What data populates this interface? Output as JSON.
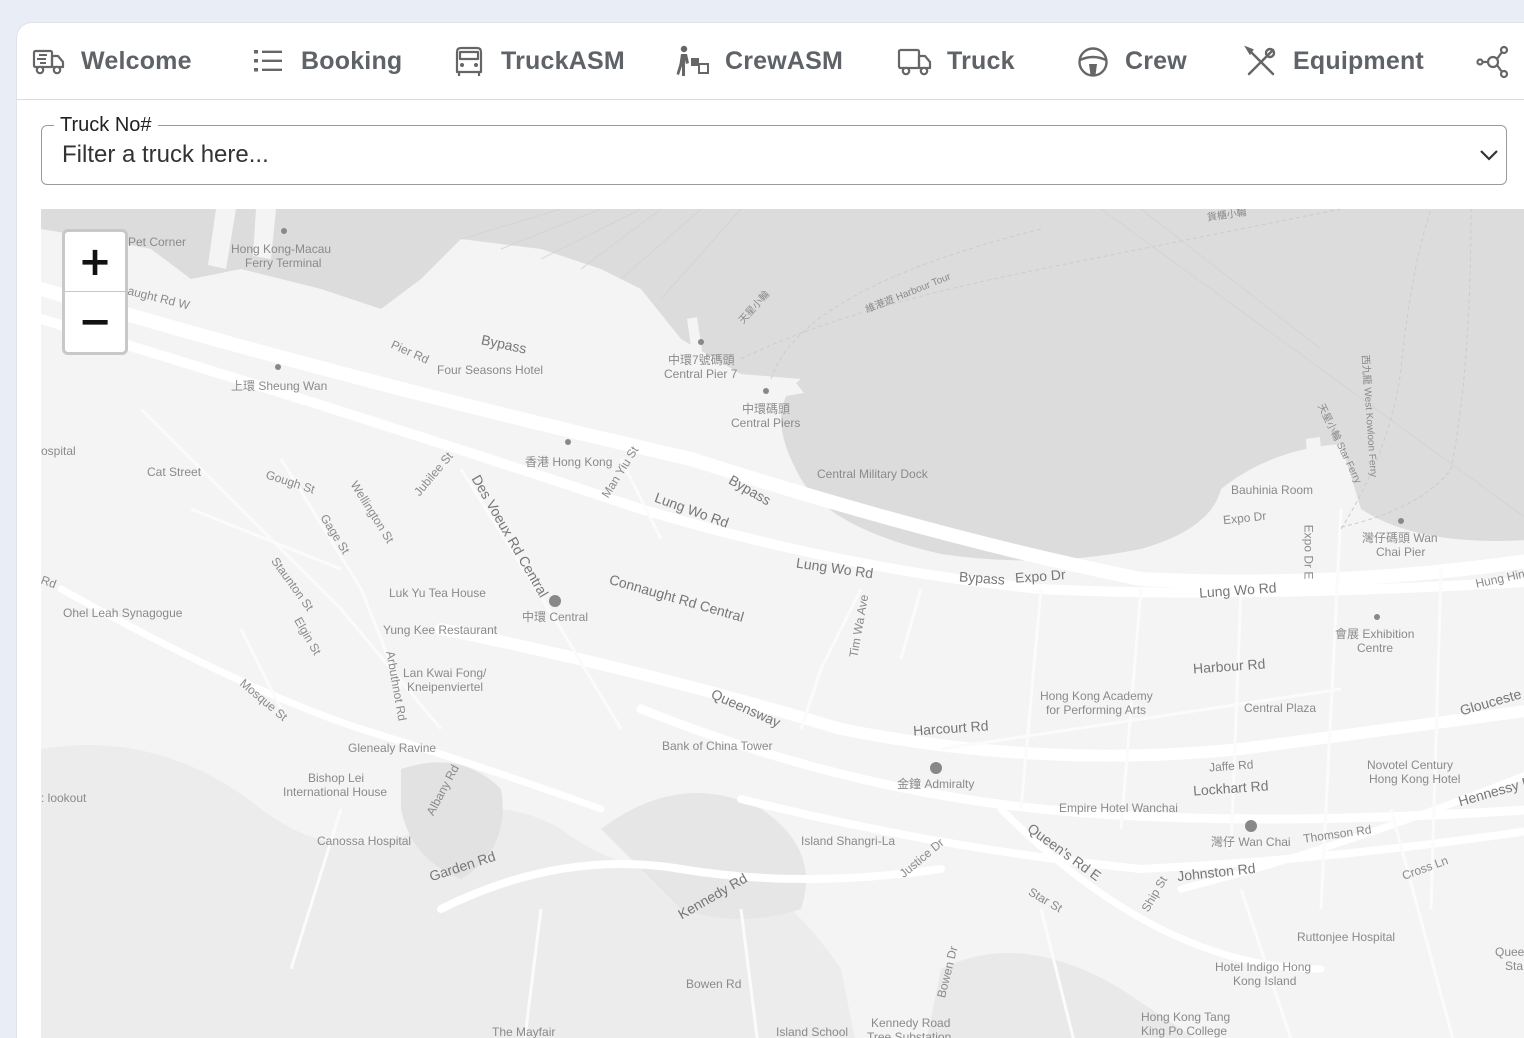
{
  "tabs": [
    {
      "name": "welcome",
      "label": "Welcome",
      "icon": "truck-fast-icon"
    },
    {
      "name": "booking",
      "label": "Booking",
      "icon": "list-icon"
    },
    {
      "name": "truckasm",
      "label": "TruckASM",
      "icon": "car-front-icon"
    },
    {
      "name": "crewasm",
      "label": "CrewASM",
      "icon": "people-carry-icon"
    },
    {
      "name": "truck",
      "label": "Truck",
      "icon": "truck-icon"
    },
    {
      "name": "crew",
      "label": "Crew",
      "icon": "steering-wheel-icon"
    },
    {
      "name": "equipment",
      "label": "Equipment",
      "icon": "tools-icon"
    },
    {
      "name": "more",
      "label": "",
      "icon": "network-icon"
    }
  ],
  "filter": {
    "legend": "Truck No#",
    "placeholder": "Filter a truck here..."
  },
  "map": {
    "zoom_in": "+",
    "zoom_out": "−",
    "labels": {
      "pet_corner": "Pet Corner",
      "hk_macau": "Hong Kong-Macau",
      "ferry_terminal": "Ferry Terminal",
      "connaught_w": "aught Rd W",
      "pier_rd": "Pier Rd",
      "bypass1": "Bypass",
      "four_seasons": "Four Seasons Hotel",
      "pier7_cn": "中環7號碼頭",
      "pier7": "Central Pier 7",
      "piers_cn": "中環碼頭",
      "piers": "Central Piers",
      "sheung_wan": "上環 Sheung Wan",
      "hospital": "ospital",
      "cat_street": "Cat Street",
      "gough_st": "Gough St",
      "wellington_st": "Wellington St",
      "jubilee_st": "Jubilee St",
      "des_voeux": "Des Voeux Rd Central",
      "hong_kong_stn": "香港 Hong Kong",
      "man_yiu_st": "Man Yiu St",
      "lung_wo_rd1": "Lung Wo Rd",
      "bypass2": "Bypass",
      "military_dock": "Central Military Dock",
      "bauhinia": "Bauhinia Room",
      "expo_dr": "Expo Dr",
      "expo_dr_e": "Expo Dr E",
      "wan_chai_pier": "灣仔碼頭 Wan",
      "wan_chai_pier2": "Chai Pier",
      "gage_st": "Gage St",
      "staunton_st": "Staunton St",
      "luk_yu": "Luk Yu Tea House",
      "central_stn": "中環 Central",
      "connaught_central": "Connaught Rd Central",
      "lung_wo_rd2": "Lung Wo Rd",
      "bypass_expo": "Bypass",
      "expo_dr2": "Expo Dr",
      "lung_wo_rd3": "Lung Wo Rd",
      "hung_hing": "Hung Hing",
      "rd": "Rd",
      "ohel_leah": "Ohel Leah Synagogue",
      "elgin_st": "Elgin St",
      "yung_kee": "Yung Kee Restaurant",
      "arbuthnot": "Arbuthnot Rd",
      "lan_kwai": "Lan Kwai Fong/",
      "kneipen": "Kneipenviertel",
      "tim_wa": "Tim Wa Ave",
      "exhibition": "會展 Exhibition",
      "centre": "Centre",
      "harbour_rd": "Harbour Rd",
      "mosque_st": "Mosque St",
      "queensway": "Queensway",
      "hkapa1": "Hong Kong Academy",
      "hkapa2": "for Performing Arts",
      "central_plaza": "Central Plaza",
      "gloucester": "Glouceste",
      "glenealy": "Glenealy Ravine",
      "bank_china": "Bank of China Tower",
      "harcourt": "Harcourt Rd",
      "bishop1": "Bishop Lei",
      "bishop2": "International House",
      "albany": "Albany Rd",
      "admiralty": "金鐘 Admiralty",
      "jaffe": "Jaffe Rd",
      "novotel1": "Novotel Century",
      "novotel2": "Hong Kong Hotel",
      "lookout": ": lookout",
      "lockhart": "Lockhart Rd",
      "hennessy": "Hennessy Rd",
      "empire": "Empire Hotel Wanchai",
      "canossa": "Canossa Hospital",
      "island_shangri": "Island Shangri-La",
      "queens_e": "Queen's Rd E",
      "wan_chai_stn": "灣仔 Wan Chai",
      "thomson": "Thomson Rd",
      "garden_rd": "Garden Rd",
      "justice_dr": "Justice Dr",
      "kennedy_rd": "Kennedy Rd",
      "star_st": "Star St",
      "ship_st": "Ship St",
      "johnston": "Johnston Rd",
      "cross_ln": "Cross Ln",
      "ruttonjee": "Ruttonjee Hospital",
      "queen_e1": "Queen E",
      "queen_e2": "Sta",
      "bowen_dr": "Bowen Dr",
      "bowen_rd": "Bowen Rd",
      "indigo1": "Hotel Indigo Hong",
      "indigo2": "Kong Island",
      "kennedy_sub1": "Kennedy Road",
      "kennedy_sub2": "Tree Substation",
      "tang1": "Hong Kong Tang",
      "tang2": "King Po College",
      "mayfair": "The Mayfair",
      "island_school": "Island School",
      "ferry_top": "貨櫃小輪",
      "harbour_tour": "維港遊 Harbour Tour",
      "star_ferry_cn": "天星小輪",
      "west_kowloon": "西九龍 West Kowloon Ferry",
      "ferry_mid": "天星小輪 Star Ferry"
    }
  }
}
